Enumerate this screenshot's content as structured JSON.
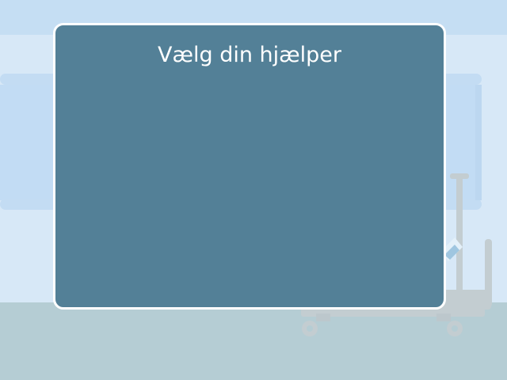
{
  "scene": {
    "name": "hospital-room",
    "colors": {
      "wall": "#d7e8f7",
      "wall_top": "#c5def3",
      "window": "#c2dcf4",
      "floor": "#b5cdd4",
      "bed": "#c3cdd1",
      "dialog_background": "#538097",
      "dialog_border": "#ffffff",
      "title_text": "#ffffff"
    }
  },
  "dialog": {
    "title": "Vælg din hjælper",
    "helpers": []
  }
}
